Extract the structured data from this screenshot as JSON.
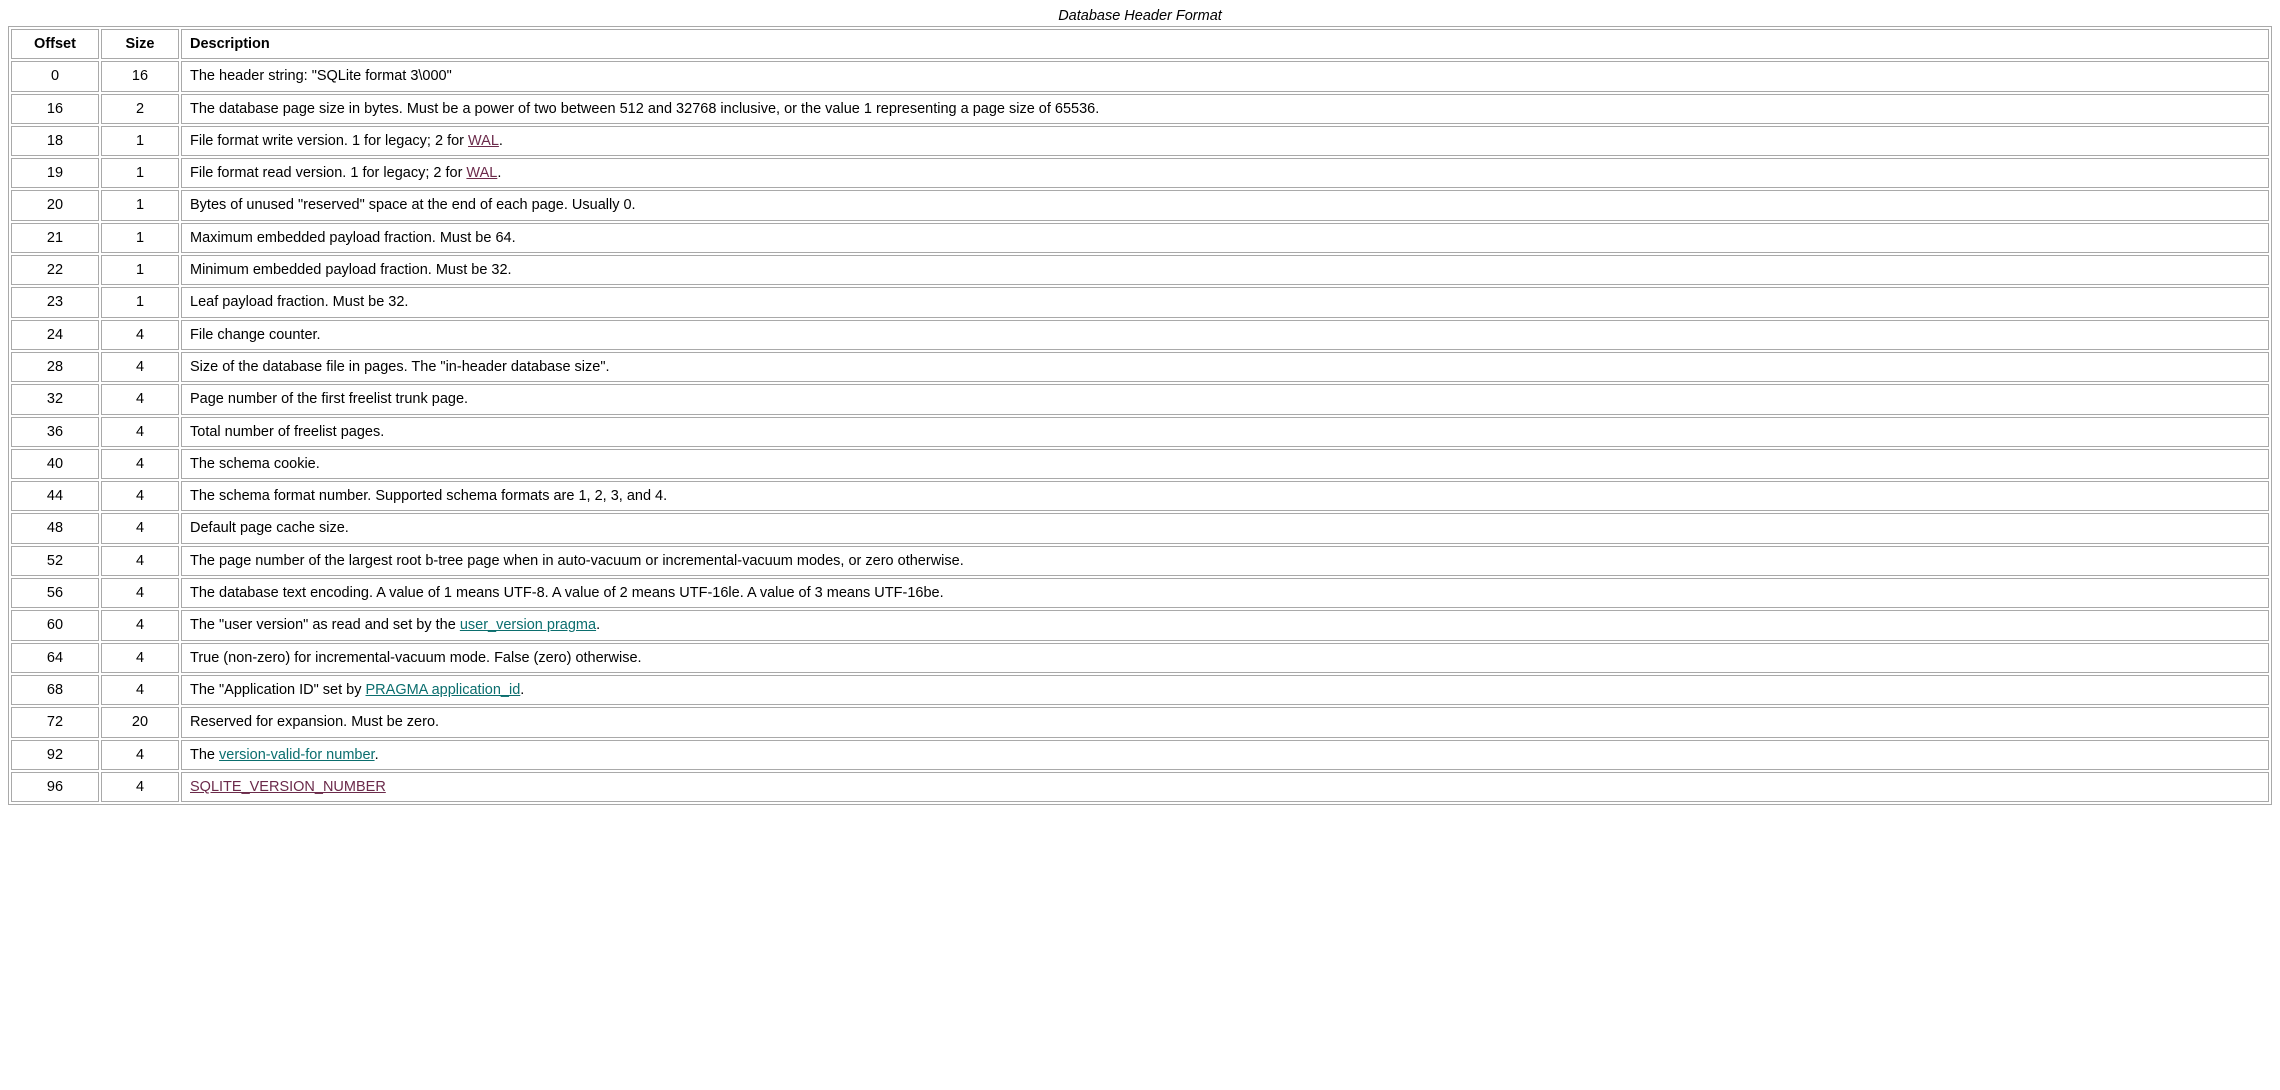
{
  "caption": "Database Header Format",
  "headers": {
    "offset": "Offset",
    "size": "Size",
    "description": "Description"
  },
  "rows": [
    {
      "offset": "0",
      "size": "16",
      "desc": [
        [
          "text",
          "The header string: \"SQLite format 3\\000\""
        ]
      ]
    },
    {
      "offset": "16",
      "size": "2",
      "desc": [
        [
          "text",
          "The database page size in bytes. Must be a power of two between 512 and 32768 inclusive, or the value 1 representing a page size of 65536."
        ]
      ]
    },
    {
      "offset": "18",
      "size": "1",
      "desc": [
        [
          "text",
          "File format write version. 1 for legacy; 2 for "
        ],
        [
          "link",
          "WAL",
          "visited"
        ],
        [
          "text",
          "."
        ]
      ]
    },
    {
      "offset": "19",
      "size": "1",
      "desc": [
        [
          "text",
          "File format read version. 1 for legacy; 2 for "
        ],
        [
          "link",
          "WAL",
          "visited"
        ],
        [
          "text",
          "."
        ]
      ]
    },
    {
      "offset": "20",
      "size": "1",
      "desc": [
        [
          "text",
          "Bytes of unused \"reserved\" space at the end of each page. Usually 0."
        ]
      ]
    },
    {
      "offset": "21",
      "size": "1",
      "desc": [
        [
          "text",
          "Maximum embedded payload fraction. Must be 64."
        ]
      ]
    },
    {
      "offset": "22",
      "size": "1",
      "desc": [
        [
          "text",
          "Minimum embedded payload fraction. Must be 32."
        ]
      ]
    },
    {
      "offset": "23",
      "size": "1",
      "desc": [
        [
          "text",
          "Leaf payload fraction. Must be 32."
        ]
      ]
    },
    {
      "offset": "24",
      "size": "4",
      "desc": [
        [
          "text",
          "File change counter."
        ]
      ]
    },
    {
      "offset": "28",
      "size": "4",
      "desc": [
        [
          "text",
          "Size of the database file in pages. The \"in-header database size\"."
        ]
      ]
    },
    {
      "offset": "32",
      "size": "4",
      "desc": [
        [
          "text",
          "Page number of the first freelist trunk page."
        ]
      ]
    },
    {
      "offset": "36",
      "size": "4",
      "desc": [
        [
          "text",
          "Total number of freelist pages."
        ]
      ]
    },
    {
      "offset": "40",
      "size": "4",
      "desc": [
        [
          "text",
          "The schema cookie."
        ]
      ]
    },
    {
      "offset": "44",
      "size": "4",
      "desc": [
        [
          "text",
          "The schema format number. Supported schema formats are 1, 2, 3, and 4."
        ]
      ]
    },
    {
      "offset": "48",
      "size": "4",
      "desc": [
        [
          "text",
          "Default page cache size."
        ]
      ]
    },
    {
      "offset": "52",
      "size": "4",
      "desc": [
        [
          "text",
          "The page number of the largest root b-tree page when in auto-vacuum or incremental-vacuum modes, or zero otherwise."
        ]
      ]
    },
    {
      "offset": "56",
      "size": "4",
      "desc": [
        [
          "text",
          "The database text encoding. A value of 1 means UTF-8. A value of 2 means UTF-16le. A value of 3 means UTF-16be."
        ]
      ]
    },
    {
      "offset": "60",
      "size": "4",
      "desc": [
        [
          "text",
          "The \"user version\" as read and set by the "
        ],
        [
          "link",
          "user_version pragma",
          "teal"
        ],
        [
          "text",
          "."
        ]
      ]
    },
    {
      "offset": "64",
      "size": "4",
      "desc": [
        [
          "text",
          "True (non-zero) for incremental-vacuum mode. False (zero) otherwise."
        ]
      ]
    },
    {
      "offset": "68",
      "size": "4",
      "desc": [
        [
          "text",
          "The \"Application ID\" set by "
        ],
        [
          "link",
          "PRAGMA application_id",
          "teal"
        ],
        [
          "text",
          "."
        ]
      ]
    },
    {
      "offset": "72",
      "size": "20",
      "desc": [
        [
          "text",
          "Reserved for expansion. Must be zero."
        ]
      ]
    },
    {
      "offset": "92",
      "size": "4",
      "desc": [
        [
          "text",
          "The "
        ],
        [
          "link",
          "version-valid-for number",
          "teal"
        ],
        [
          "text",
          "."
        ]
      ]
    },
    {
      "offset": "96",
      "size": "4",
      "desc": [
        [
          "link",
          "SQLITE_VERSION_NUMBER",
          "visited"
        ]
      ]
    }
  ]
}
